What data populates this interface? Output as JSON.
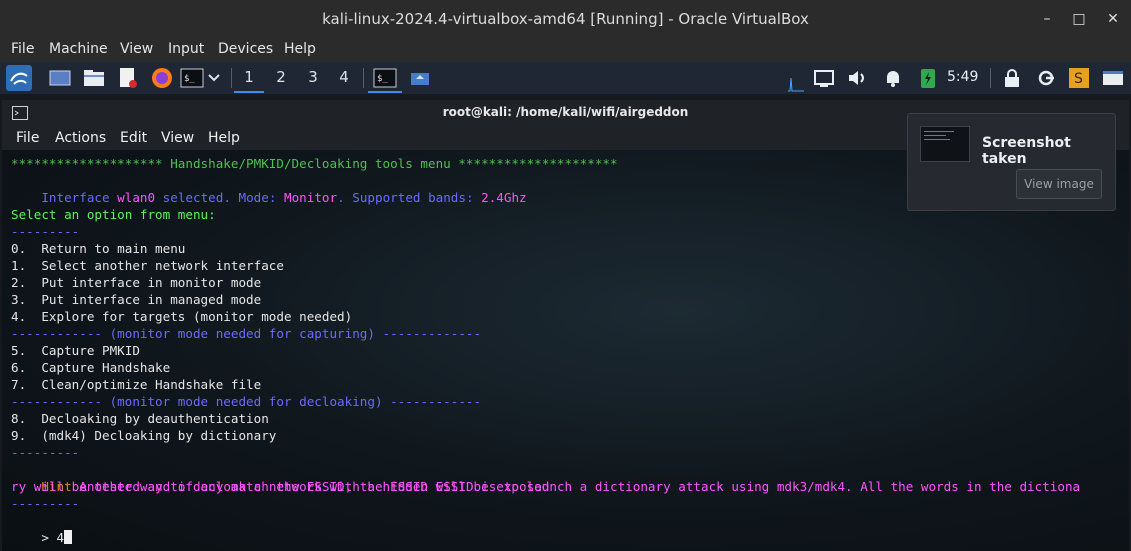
{
  "vbox": {
    "title": "kali-linux-2024.4-virtualbox-amd64 [Running] - Oracle VirtualBox",
    "menu": [
      "File",
      "Machine",
      "View",
      "Input",
      "Devices",
      "Help"
    ],
    "minimize": "–",
    "maximize": "□",
    "close": "✕"
  },
  "panel": {
    "workspaces": [
      "1",
      "2",
      "3",
      "4"
    ],
    "clock": "5:49",
    "icons": [
      "kali-menu-icon",
      "desktop-icon",
      "files-icon",
      "text-editor-icon",
      "firefox-icon",
      "terminal-icon",
      "chevron-down-icon",
      "terminal-task-icon",
      "home-folder-task-icon",
      "network-icon",
      "volume-icon",
      "notifications-icon",
      "battery-icon",
      "lock-icon",
      "logout-icon",
      "screenshot-tool-icon",
      "show-desktop-icon"
    ]
  },
  "terminal": {
    "title": "root@kali: /home/kali/wifi/airgeddon",
    "menu": [
      "File",
      "Actions",
      "Edit",
      "View",
      "Help"
    ],
    "lines": {
      "header": "******************** Handshake/PMKID/Decloaking tools menu *********************",
      "iface_prefix": "Interface ",
      "iface_name": "wlan0",
      "iface_mid": " selected. Mode: ",
      "iface_mode": "Monitor",
      "iface_bands": ". Supported bands: ",
      "iface_band_val": "2.4Ghz",
      "select": "Select an option from menu:",
      "sep1": "---------",
      "opt0": "0.  Return to main menu",
      "opt1": "1.  Select another network interface",
      "opt2": "2.  Put interface in monitor mode",
      "opt3": "3.  Put interface in managed mode",
      "opt4": "4.  Explore for targets (monitor mode needed)",
      "sep_capture": "------------ (monitor mode needed for capturing) -------------",
      "opt5": "5.  Capture PMKID",
      "opt6": "6.  Capture Handshake",
      "opt7": "7.  Clean/optimize Handshake file",
      "sep_decloak": "------------ (monitor mode needed for decloaking) ------------",
      "opt8": "8.  Decloaking by deauthentication",
      "opt9": "9.  (mdk4) Decloaking by dictionary",
      "sep2": "---------",
      "hint_label": "Hint",
      "hint_text1": " Another way to decloak a network with a hidden ESSID is to launch a dictionary attack using mdk3/mdk4. All the words in the dictiona",
      "hint_text2": "ry will be tested and if any match the ESSID, the ESSID will be exposed",
      "sep3": "---------",
      "prompt": "> ",
      "input": "4"
    }
  },
  "notification": {
    "title": "Screenshot taken",
    "button": "View image"
  }
}
